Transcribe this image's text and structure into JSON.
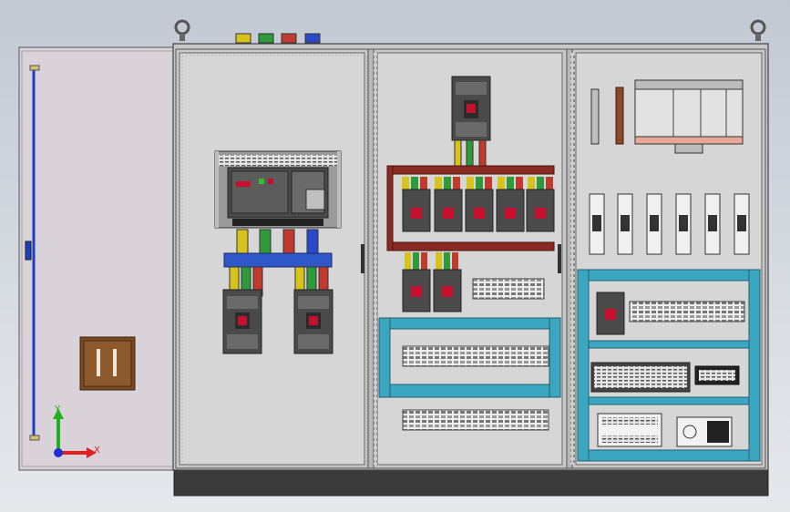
{
  "viewport": {
    "background_top": "#c2c9d3",
    "background_bottom": "#e6e8ec"
  },
  "palette": {
    "cabinet_frame": "#c8c8c8",
    "panel_fill": "#d6d6d6",
    "door_fill": "#d9d2d8",
    "plinth": "#3a3a3a",
    "busbar_red": "#8b2a22",
    "busbar_blue": "#2f57c8",
    "duct_cyan": "#3aa6c0",
    "phase_yellow": "#d8c21c",
    "phase_green": "#2f9a3a",
    "phase_red": "#c23a2c",
    "phase_blue": "#2a48c8",
    "breaker_dark": "#4a4a4a",
    "breaker_red": "#c8102e",
    "handle_brown": "#7a4a22",
    "door_rod": "#1f3fbf"
  },
  "icons": {
    "lifting_eye": "lifting-eye-icon",
    "triad": "coordinate-triad-icon"
  },
  "triad": {
    "x_label": "X",
    "y_label": "Y",
    "x_color": "#e02020",
    "y_color": "#20b020",
    "origin_color": "#2030d0"
  },
  "components": {
    "main_acb": {
      "phase_count": 4
    },
    "mccb_row_breakers": 5,
    "lower_breakers": 2,
    "right_top_breakers": 6,
    "terminal_strips": 4
  }
}
